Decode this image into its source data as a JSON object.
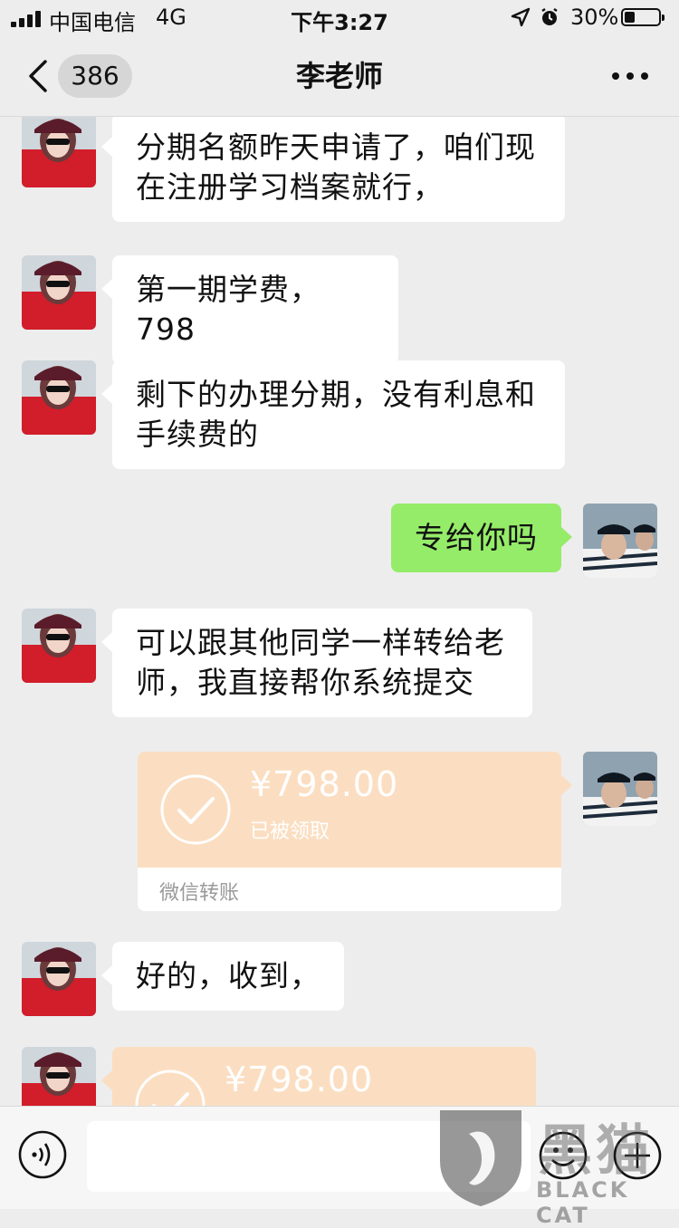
{
  "status_bar": {
    "carrier": "中国电信",
    "network": "4G",
    "time": "下午3:27",
    "battery_percent": "30%",
    "battery_level": 0.3
  },
  "nav": {
    "unread_count": "386",
    "title": "李老师"
  },
  "messages": [
    {
      "side": "in",
      "type": "text",
      "text": "分期名额昨天申请了，咱们现在注册学习档案就行，"
    },
    {
      "side": "in",
      "type": "text",
      "text": "第一期学费，798"
    },
    {
      "side": "in",
      "type": "text",
      "text": "剩下的办理分期，没有利息和手续费的"
    },
    {
      "side": "out",
      "type": "text",
      "text": "专给你吗"
    },
    {
      "side": "in",
      "type": "text",
      "text": "可以跟其他同学一样转给老师，我直接帮你系统提交"
    },
    {
      "side": "out",
      "type": "transfer",
      "amount": "¥798.00",
      "status": "已被领取",
      "label": "微信转账"
    },
    {
      "side": "in",
      "type": "text",
      "text": "好的，收到，"
    },
    {
      "side": "in",
      "type": "transfer",
      "amount": "¥798.00"
    }
  ],
  "watermark": {
    "cn": "黑猫",
    "en": "BLACK CAT"
  },
  "colors": {
    "background": "#ededed",
    "bubble_out": "#95ec69",
    "bubble_in": "#ffffff",
    "transfer": "#fbdec1"
  },
  "icons": [
    "signal-icon",
    "location-icon",
    "alarm-icon",
    "battery-icon",
    "back-chevron-icon",
    "more-icon",
    "check-icon",
    "voice-icon",
    "emoji-icon",
    "plus-icon"
  ]
}
